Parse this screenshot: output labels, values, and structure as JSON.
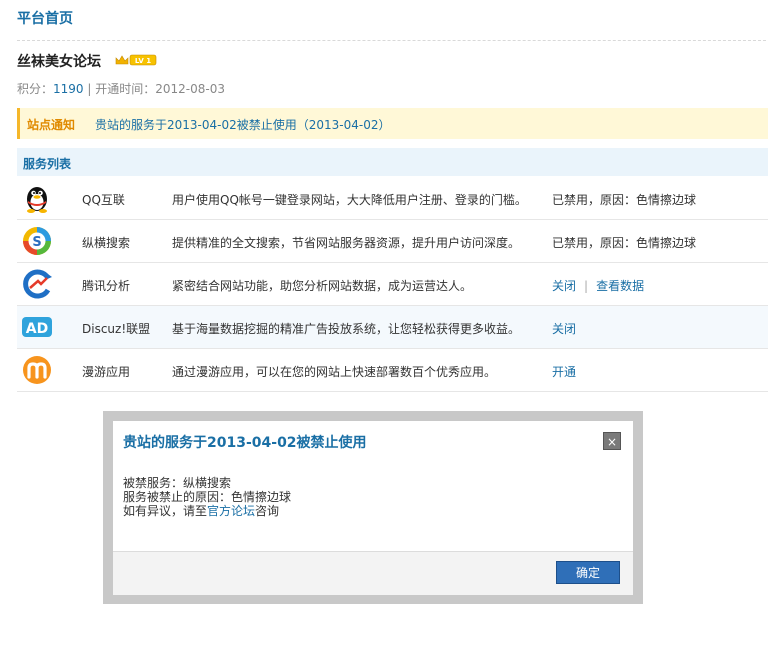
{
  "header": {
    "title": "平台首页"
  },
  "site": {
    "name": "丝袜美女论坛",
    "level": "LV 1",
    "points_label": "积分：",
    "points": "1190",
    "separator": " | ",
    "open_label": "开通时间：",
    "open_date": "2012-08-03"
  },
  "notice": {
    "label": "站点通知",
    "message": "贵站的服务于2013-04-02被禁止使用（2013-04-02）"
  },
  "services": {
    "heading": "服务列表",
    "items": [
      {
        "icon": "qq-penguin-icon",
        "name": "QQ互联",
        "desc": "用户使用QQ帐号一键登录网站，大大降低用户注册、登录的门槛。",
        "status": "已禁用，原因：色情擦边球"
      },
      {
        "icon": "soso-search-icon",
        "name": "纵横搜索",
        "desc": "提供精准的全文搜索，节省网站服务器资源，提升用户访问深度。",
        "status": "已禁用，原因：色情擦边球"
      },
      {
        "icon": "tencent-analytics-icon",
        "name": "腾讯分析",
        "desc": "紧密结合网站功能，助您分析网站数据，成为运营达人。",
        "action1": "关闭",
        "action_sep": "|",
        "action2": "查看数据"
      },
      {
        "icon": "ad-league-icon",
        "name": "Discuz!联盟",
        "desc": "基于海量数据挖掘的精准广告投放系统，让您轻松获得更多收益。",
        "action1": "关闭"
      },
      {
        "icon": "manyou-icon",
        "name": "漫游应用",
        "desc": "通过漫游应用，可以在您的网站上快速部署数百个优秀应用。",
        "action1": "开通"
      }
    ]
  },
  "dialog": {
    "title": "贵站的服务于2013-04-02被禁止使用",
    "close": "×",
    "line1": "被禁服务：纵横搜索",
    "line2": "服务被禁止的原因：色情擦边球",
    "line3_prefix": "如有异议，请至",
    "line3_link": "官方论坛",
    "line3_suffix": "咨询",
    "ok": "确定"
  },
  "colors": {
    "accent": "#1a6fa5",
    "notice_bg": "#fff8d7",
    "notice_border": "#f5b72a"
  }
}
